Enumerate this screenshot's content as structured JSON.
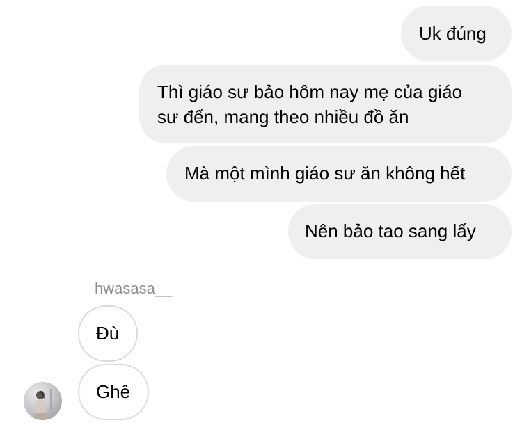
{
  "messages_sent": [
    {
      "text": "Uk đúng"
    },
    {
      "lines": [
        "Thì giáo sư bảo hôm nay mẹ của giáo",
        "sư đến, mang theo nhiều đồ ăn"
      ]
    },
    {
      "text": "Mà một mình giáo sư ăn không hết"
    },
    {
      "text": "Nên bảo tao sang lấy"
    }
  ],
  "received_group": {
    "sender_name": "hwasasa__",
    "messages": [
      {
        "text": "Đù"
      },
      {
        "text": "Ghê"
      }
    ]
  },
  "colors": {
    "sent_bubble": "#efefef",
    "received_bubble_border": "#dbdbdb",
    "sender_name": "#8e8e8e",
    "text": "#000000"
  }
}
